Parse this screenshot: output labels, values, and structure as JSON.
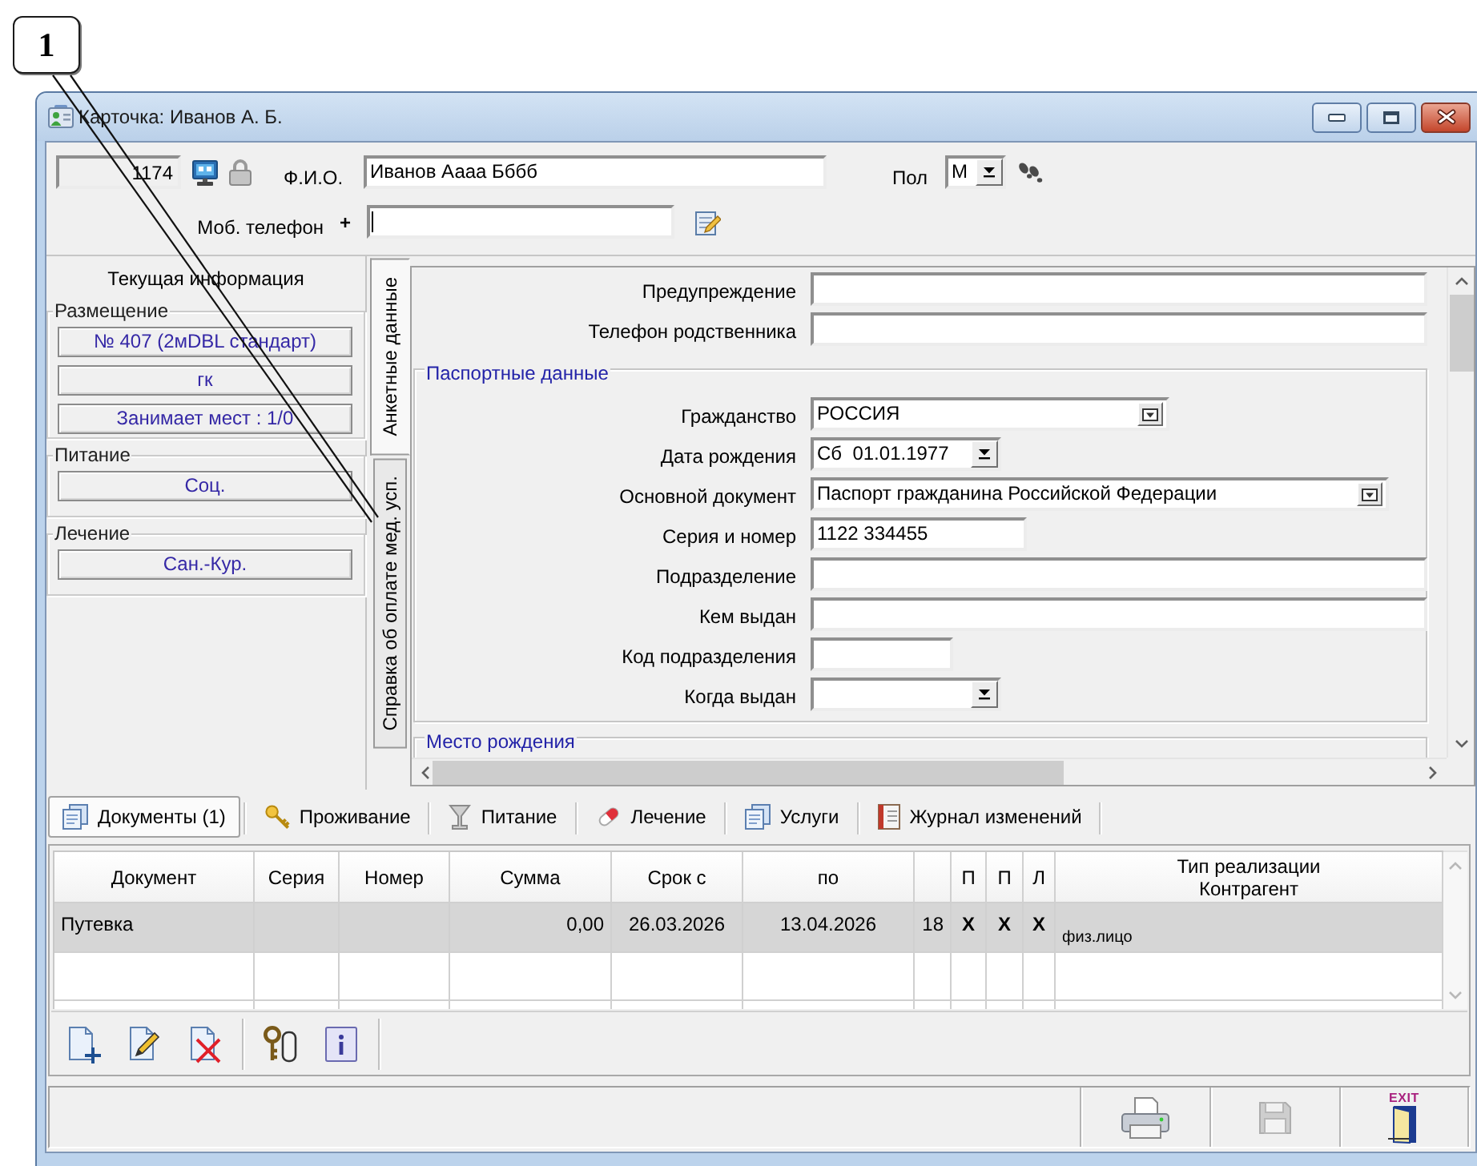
{
  "callout": {
    "label": "1"
  },
  "window": {
    "title": "Карточка: Иванов А. Б."
  },
  "header": {
    "record_id": {
      "value": "1174"
    },
    "full_name": {
      "label": "Ф.И.О.",
      "value": "Иванов Аааа Бббб"
    },
    "sex": {
      "label": "Пол",
      "value": "М"
    },
    "mobile_phone": {
      "label": "Моб. телефон",
      "marker": "+",
      "focused": true
    }
  },
  "info_panel": {
    "title": "Текущая информация",
    "groups": [
      {
        "title": "Размещение",
        "items": [
          "№ 407 (2мDBL стандарт)",
          "гк",
          "Занимает мест : 1/0"
        ]
      },
      {
        "title": "Питание",
        "items": [
          "Соц."
        ]
      },
      {
        "title": "Лечение",
        "items": [
          "Сан.-Кур."
        ]
      }
    ]
  },
  "side_tabs": [
    {
      "label": "Анкетные данные",
      "selected": true
    },
    {
      "label": "Справка об оплате мед. усп.",
      "selected": false
    }
  ],
  "form": {
    "fields": [
      {
        "kind": "text",
        "label": "Предупреждение"
      },
      {
        "kind": "text",
        "label": "Телефон родственника"
      }
    ],
    "sections": [
      {
        "title": "Паспортные данные",
        "fields": [
          {
            "kind": "combo",
            "label": "Гражданство",
            "value": "РОССИЯ"
          },
          {
            "kind": "date",
            "label": "Дата рождения",
            "value": "Сб  01.01.1977"
          },
          {
            "kind": "combo",
            "label": "Основной документ",
            "value": "Паспорт гражданина Российской Федерации"
          },
          {
            "kind": "text",
            "label": "Серия и номер",
            "value": "1122 334455"
          },
          {
            "kind": "text",
            "label": "Подразделение"
          },
          {
            "kind": "text",
            "label": "Кем выдан"
          },
          {
            "kind": "text",
            "label": "Код подразделения"
          },
          {
            "kind": "date",
            "label": "Когда выдан"
          }
        ]
      },
      {
        "title": "Место рождения"
      }
    ]
  },
  "bottom_tabs": [
    {
      "label": "Документы (1)",
      "selected": true
    },
    {
      "label": "Проживание",
      "selected": false
    },
    {
      "label": "Питание",
      "selected": false
    },
    {
      "label": "Лечение",
      "selected": false
    },
    {
      "label": "Услуги",
      "selected": false
    },
    {
      "label": "Журнал изменений",
      "selected": false
    }
  ],
  "table": {
    "columns": [
      {
        "kind": "text",
        "label": "Документ"
      },
      {
        "kind": "text",
        "label": "Серия"
      },
      {
        "kind": "text",
        "label": "Номер"
      },
      {
        "kind": "money",
        "label": "Сумма"
      },
      {
        "kind": "date",
        "label": "Срок с"
      },
      {
        "kind": "date",
        "label": "по"
      },
      {
        "kind": "count"
      },
      {
        "kind": "flag",
        "label": "П"
      },
      {
        "kind": "flag",
        "label": "П"
      },
      {
        "kind": "flag",
        "label": "Л"
      },
      {
        "kind": "note",
        "label": "Тип реализации\nКонтрагент"
      }
    ],
    "rows": [
      {
        "selected": true,
        "cells": [
          {
            "text": "Путевка"
          },
          {},
          {},
          {
            "text": "0,00"
          },
          {
            "text": "26.03.2026"
          },
          {
            "text": "13.04.2026"
          },
          {
            "text": "18"
          },
          {
            "text": "X"
          },
          {
            "text": "X"
          },
          {
            "text": "X"
          },
          {
            "text": "физ.лицо"
          }
        ]
      },
      {
        "selected": false
      }
    ]
  },
  "toolbar": {
    "groups": [
      [
        {
          "kind": "new"
        },
        {
          "kind": "edit"
        },
        {
          "kind": "delete"
        }
      ],
      [
        {
          "kind": "keys"
        },
        {
          "kind": "info"
        }
      ]
    ]
  },
  "status_bar": {
    "buttons": [
      {
        "kind": "print",
        "disabled": false
      },
      {
        "kind": "save",
        "disabled": true
      },
      {
        "kind": "exit",
        "label": "EXIT",
        "disabled": false
      }
    ]
  }
}
